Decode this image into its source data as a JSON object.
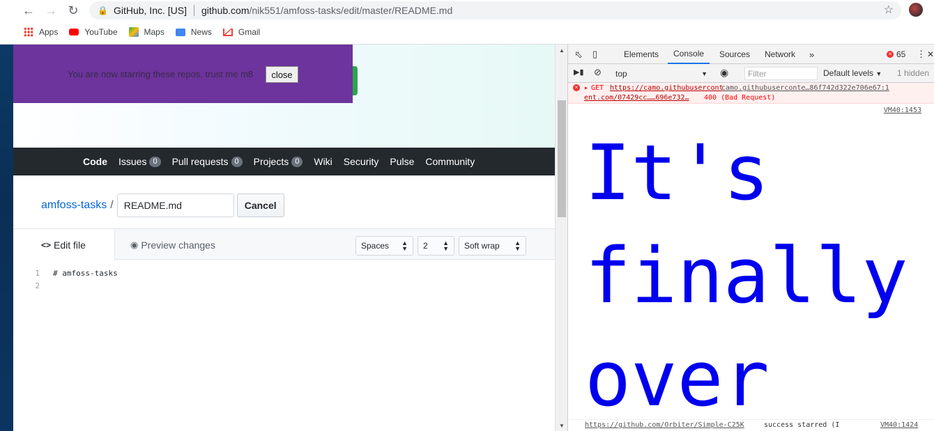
{
  "browser": {
    "omnibox": {
      "site_label": "GitHub, Inc. [US]",
      "host": "github.com",
      "path": "/nik551/amfoss-tasks/edit/master/README.md"
    },
    "bookmarks": [
      "Apps",
      "YouTube",
      "Maps",
      "News",
      "Gmail"
    ]
  },
  "banner": {
    "text": "You are now starring these repos, trust me m8",
    "close_label": "close"
  },
  "repo_nav": {
    "code": "Code",
    "issues": "Issues",
    "issues_count": "0",
    "pulls": "Pull requests",
    "pulls_count": "0",
    "projects": "Projects",
    "projects_count": "0",
    "wiki": "Wiki",
    "security": "Security",
    "pulse": "Pulse",
    "community": "Community"
  },
  "editor": {
    "repo_name": "amfoss-tasks",
    "slash": "/",
    "filename": "README.md",
    "cancel_label": "Cancel",
    "tab_edit": "Edit file",
    "tab_preview": "Preview changes",
    "indent_mode": "Spaces",
    "indent_size": "2",
    "wrap_mode": "Soft wrap",
    "lines": [
      {
        "num": "1",
        "text": "# amfoss-tasks"
      },
      {
        "num": "2",
        "text": ""
      }
    ]
  },
  "devtools": {
    "tabs": [
      "Elements",
      "Console",
      "Sources",
      "Network"
    ],
    "error_count": "65",
    "context": "top",
    "filter_placeholder": "Filter",
    "levels": "Default levels",
    "hidden": "1 hidden",
    "error": {
      "method": "GET",
      "url1": "https://camo.githubusercont",
      "url2": "camo.githubuserconte…86f742d322e706e67:1",
      "url3": "ent.com/07429cc……696e732…",
      "status": "400 (Bad Request)"
    },
    "vm_ref_1": "VM40:1453",
    "big_lines": [
      "It's",
      "finally",
      "over"
    ],
    "bottom_link": "https://github.com/Orbiter/Simple-C25K",
    "bottom_text": "success starred (I",
    "vm_ref_2": "VM40:1424"
  }
}
